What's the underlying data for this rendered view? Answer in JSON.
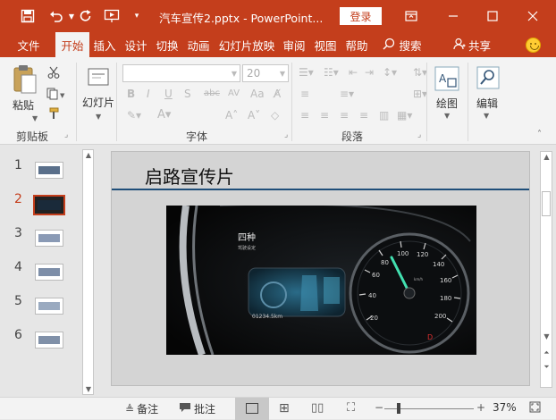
{
  "titlebar": {
    "title": "汽车宣传2.pptx - PowerPoint...",
    "login": "登录",
    "qat_icons": [
      "save-icon",
      "undo-icon",
      "redo-icon",
      "present-icon",
      "customize-icon"
    ]
  },
  "tabs": [
    {
      "label": "文件"
    },
    {
      "label": "开始"
    },
    {
      "label": "插入"
    },
    {
      "label": "设计"
    },
    {
      "label": "切换"
    },
    {
      "label": "动画"
    },
    {
      "label": "幻灯片放映"
    },
    {
      "label": "审阅"
    },
    {
      "label": "视图"
    },
    {
      "label": "帮助"
    }
  ],
  "active_tab": "开始",
  "search_label": "搜索",
  "share_label": "共享",
  "ribbon": {
    "clipboard": {
      "paste": "粘贴",
      "group": "剪贴板"
    },
    "slides": {
      "new_slide": "幻灯片",
      "group": ""
    },
    "font": {
      "font_name": "",
      "font_size": "20",
      "group": "字体"
    },
    "paragraph": {
      "group": "段落"
    },
    "drawing": {
      "label": "绘图"
    },
    "editing": {
      "label": "编辑"
    }
  },
  "thumbnails": [
    {
      "num": "1",
      "selected": false
    },
    {
      "num": "2",
      "selected": true
    },
    {
      "num": "3",
      "selected": false
    },
    {
      "num": "4",
      "selected": false
    },
    {
      "num": "5",
      "selected": false
    },
    {
      "num": "6",
      "selected": false
    }
  ],
  "slide": {
    "title": "启路宣传片",
    "image_text": {
      "mode": "四种",
      "mode_sub": "驾驶设定",
      "odometer": "01234.5km",
      "speed_marks": [
        "20",
        "40",
        "60",
        "80",
        "100",
        "120",
        "140",
        "160",
        "180",
        "200"
      ],
      "unit": "km/h",
      "gear": "D"
    }
  },
  "status": {
    "notes": "备注",
    "comments": "批注",
    "zoom": "37%"
  },
  "colors": {
    "accent": "#c43e1c",
    "slide_rule": "#1f4e79"
  }
}
